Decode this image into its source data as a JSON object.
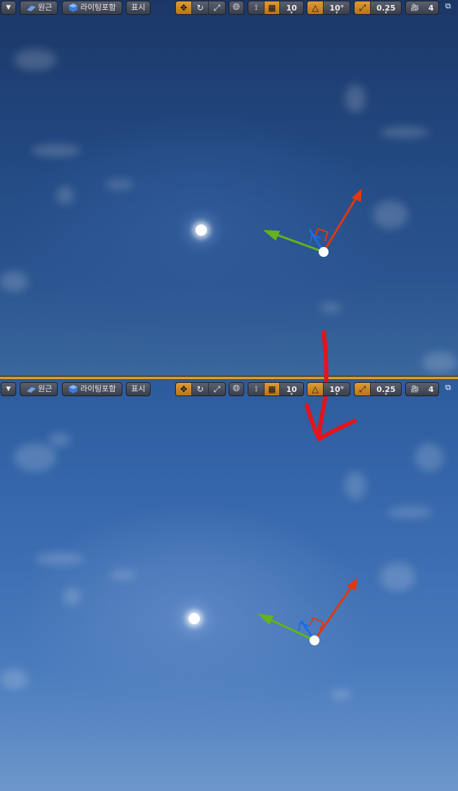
{
  "toolbar": {
    "dropdown_icon": "chevron-down-icon",
    "perspective_label": "원근",
    "lighting_label": "라이팅포함",
    "show_label": "표시",
    "grid_snap_value": "10",
    "rotation_snap_value": "10°",
    "scale_snap_value": "0.25",
    "camera_speed_value": "4",
    "accent_color": "#c98828"
  },
  "top_viewport": {
    "sky_top_color": "#1b3767",
    "sky_bottom_color": "#3a679e"
  },
  "bottom_viewport": {
    "sky_top_color": "#2c5c9e",
    "sky_bottom_color": "#6d97cb"
  },
  "annotation": {
    "arrow_color": "#e3141b"
  }
}
